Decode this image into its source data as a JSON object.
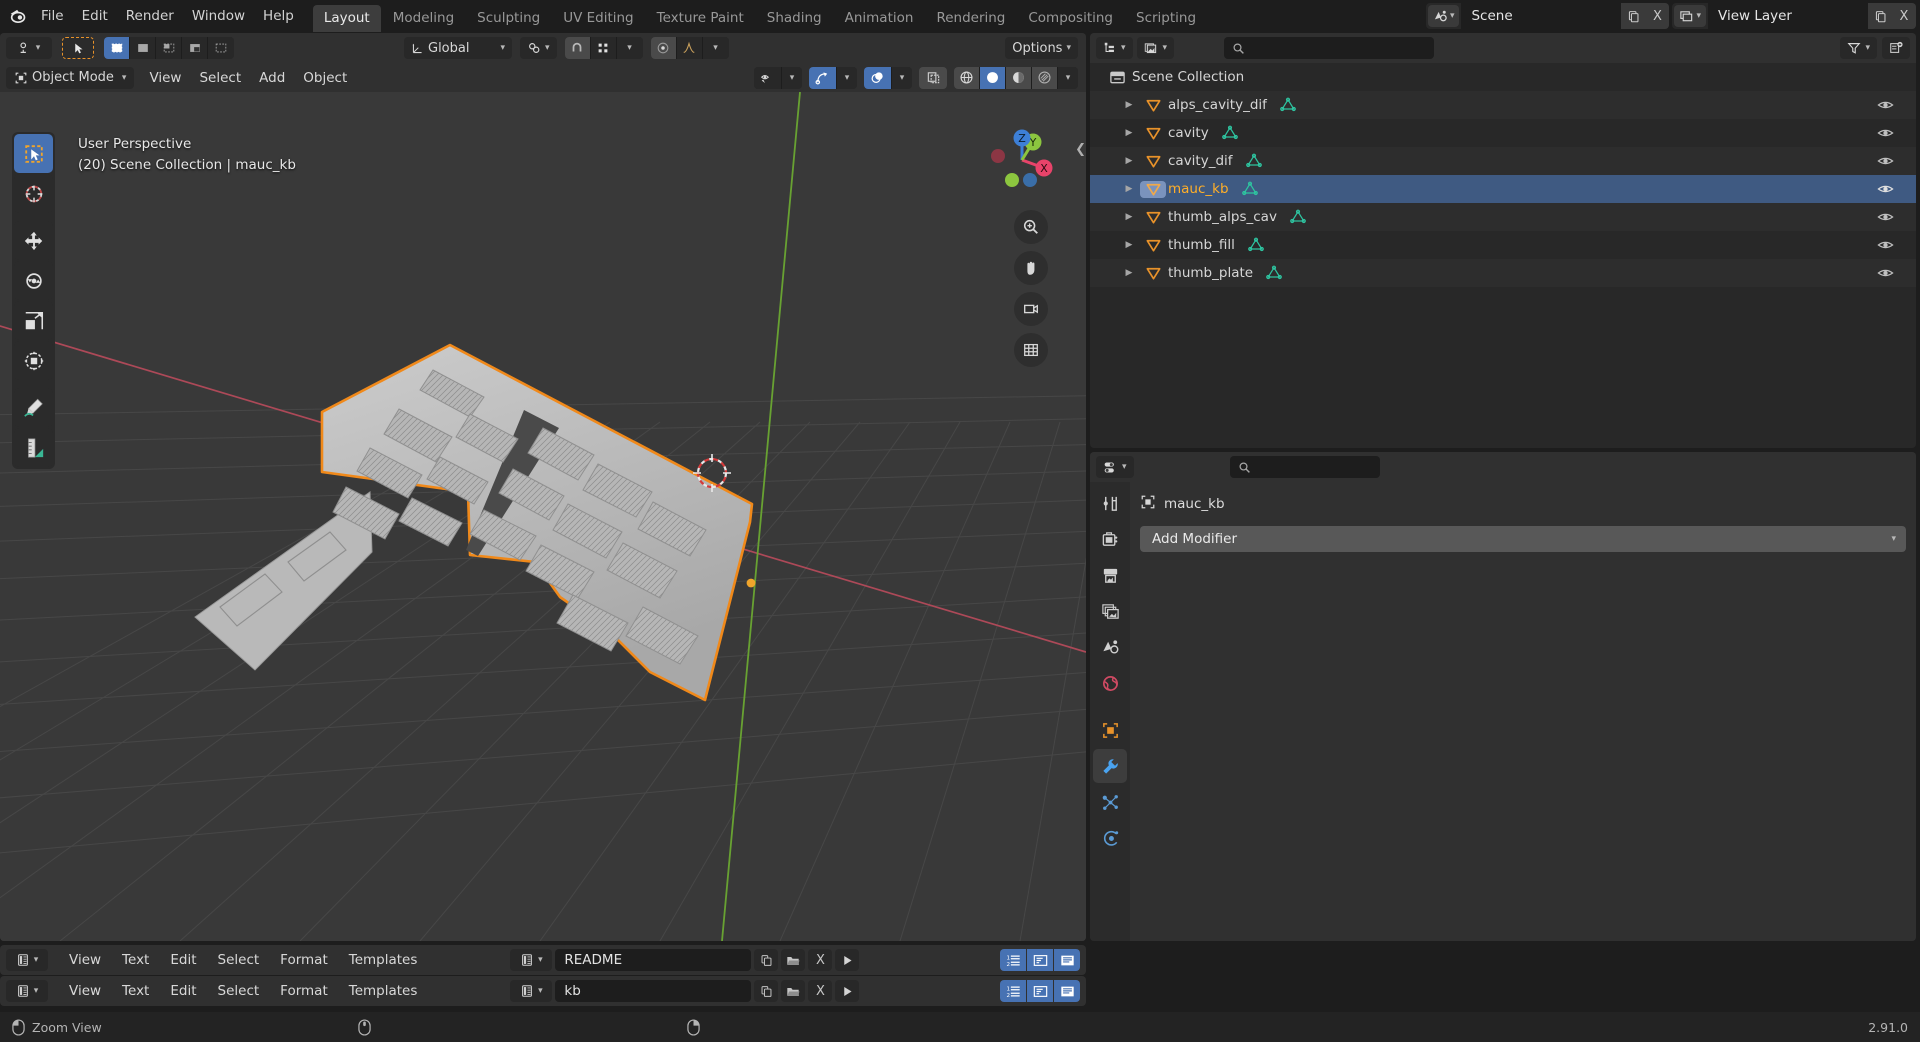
{
  "app": {
    "name": "Blender",
    "version": "2.91.0"
  },
  "topbar": {
    "menus": [
      "File",
      "Edit",
      "Render",
      "Window",
      "Help"
    ],
    "workspaces": [
      {
        "label": "Layout",
        "active": true
      },
      {
        "label": "Modeling",
        "active": false
      },
      {
        "label": "Sculpting",
        "active": false
      },
      {
        "label": "UV Editing",
        "active": false
      },
      {
        "label": "Texture Paint",
        "active": false
      },
      {
        "label": "Shading",
        "active": false
      },
      {
        "label": "Animation",
        "active": false
      },
      {
        "label": "Rendering",
        "active": false
      },
      {
        "label": "Compositing",
        "active": false
      },
      {
        "label": "Scripting",
        "active": false
      }
    ],
    "scene": {
      "icon": "scene-icon",
      "name": "Scene",
      "new_btn": "new-scene-icon",
      "unlink_btn": "X"
    },
    "view_layer": {
      "icon": "viewlayer-icon",
      "name": "View Layer",
      "new_btn": "new-layer-icon",
      "remove_btn": "X"
    }
  },
  "viewport": {
    "header": {
      "editor_type": "editor-type-3dview",
      "mode": "Object Mode",
      "menus": [
        "View",
        "Select",
        "Add",
        "Object"
      ],
      "transform_orientation": "Global",
      "options_label": "Options",
      "snap_icon": "magnet-icon",
      "proportional_icon": "proportional-edit-icon",
      "pivot_icon": "pivot-point-icon"
    },
    "overlay_text": {
      "line1": "User Perspective",
      "line2": "(20) Scene Collection | mauc_kb"
    },
    "toolbar_tools": [
      {
        "name": "tweak-select-box-tool",
        "active": true
      },
      {
        "name": "cursor-tool",
        "active": false
      },
      {
        "name": "move-tool",
        "active": false
      },
      {
        "name": "rotate-tool",
        "active": false
      },
      {
        "name": "scale-tool",
        "active": false
      },
      {
        "name": "transform-tool",
        "active": false
      },
      {
        "name": "annotate-tool",
        "active": false
      },
      {
        "name": "measure-tool",
        "active": false
      }
    ],
    "gizmo_axes": [
      {
        "label": "Z",
        "color": "#3d7fd6"
      },
      {
        "label": "Y",
        "color": "#8cc63f"
      },
      {
        "label": "X",
        "color": "#e8436a"
      }
    ],
    "nav_buttons": [
      "zoom-icon",
      "pan-hand-icon",
      "camera-view-icon",
      "toggle-ortho-icon"
    ],
    "shading_modes": [
      "wireframe-shading",
      "solid-shading",
      "material-preview-shading",
      "rendered-shading"
    ],
    "active_shading": "solid-shading"
  },
  "outliner": {
    "header": {
      "display_mode": "outliner-display-mode-icon",
      "filter_id": "filter-id-icon",
      "search_placeholder": "",
      "filter_icon": "funnel-icon",
      "new_collection_icon": "new-collection-icon"
    },
    "root": {
      "label": "Scene Collection",
      "icon": "collection-icon"
    },
    "items": [
      {
        "label": "alps_cavity_dif",
        "icon": "mesh-object-icon",
        "has_mesh_data": true,
        "selected": false,
        "visible": true
      },
      {
        "label": "cavity",
        "icon": "mesh-object-icon",
        "has_mesh_data": true,
        "selected": false,
        "visible": true
      },
      {
        "label": "cavity_dif",
        "icon": "mesh-object-icon",
        "has_mesh_data": true,
        "selected": false,
        "visible": true
      },
      {
        "label": "mauc_kb",
        "icon": "mesh-object-icon",
        "has_mesh_data": true,
        "selected": true,
        "visible": true
      },
      {
        "label": "thumb_alps_cav",
        "icon": "mesh-object-icon",
        "has_mesh_data": true,
        "selected": false,
        "visible": true
      },
      {
        "label": "thumb_fill",
        "icon": "mesh-object-icon",
        "has_mesh_data": true,
        "selected": false,
        "visible": true
      },
      {
        "label": "thumb_plate",
        "icon": "mesh-object-icon",
        "has_mesh_data": true,
        "selected": false,
        "visible": true
      }
    ]
  },
  "properties": {
    "header": {
      "display_mode": "properties-editor-icon",
      "search_placeholder": ""
    },
    "tabs": [
      {
        "name": "tool-tab",
        "active": false
      },
      {
        "name": "render-tab",
        "active": false
      },
      {
        "name": "output-tab",
        "active": false
      },
      {
        "name": "view-layer-tab",
        "active": false
      },
      {
        "name": "scene-tab",
        "active": false
      },
      {
        "name": "world-tab",
        "active": false
      },
      {
        "name": "object-tab",
        "active": false
      },
      {
        "name": "modifier-tab",
        "active": true
      },
      {
        "name": "particles-tab",
        "active": false
      },
      {
        "name": "physics-tab",
        "active": false
      }
    ],
    "breadcrumb": {
      "icon": "object-icon",
      "label": "mauc_kb"
    },
    "pin_icon": "pin-icon",
    "add_modifier_label": "Add Modifier"
  },
  "text_editors": [
    {
      "editor_icon": "text-editor-icon",
      "menus": [
        "View",
        "Text",
        "Edit",
        "Select",
        "Format",
        "Templates"
      ],
      "datablock_icon": "text-datablock-icon",
      "filename": "README",
      "buttons": [
        "duplicate-icon",
        "open-file-icon",
        "unlink-icon",
        "run-script-icon"
      ],
      "toggles": [
        "line-numbers-toggle",
        "word-wrap-toggle",
        "syntax-highlight-toggle"
      ]
    },
    {
      "editor_icon": "text-editor-icon",
      "menus": [
        "View",
        "Text",
        "Edit",
        "Select",
        "Format",
        "Templates"
      ],
      "datablock_icon": "text-datablock-icon",
      "filename": "kb",
      "buttons": [
        "duplicate-icon",
        "open-file-icon",
        "unlink-icon",
        "run-script-icon"
      ],
      "toggles": [
        "line-numbers-toggle",
        "word-wrap-toggle",
        "syntax-highlight-toggle"
      ]
    }
  ],
  "statusbar": {
    "hint_label": "Zoom View",
    "mouse_icons": [
      "mouse-left-icon",
      "mouse-middle-icon",
      "mouse-right-icon"
    ],
    "version": "2.91.0"
  },
  "colors": {
    "accent_blue": "#4772b3",
    "selected_orange": "#ffaf29",
    "outliner_select": "#3f5a82",
    "mesh_icon_orange": "#e8922a",
    "mesh_data_green": "#2ec4a0",
    "bg_dark": "#1d1d1d",
    "bg_editor": "#303030",
    "viewport_bg": "#393939"
  }
}
